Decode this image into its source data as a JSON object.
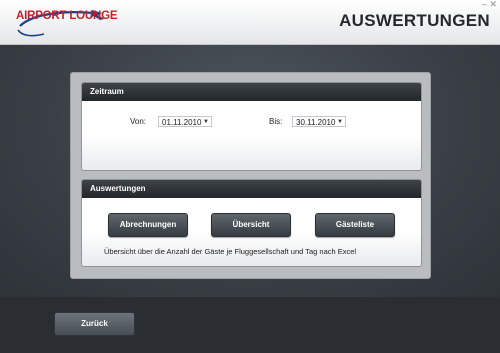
{
  "header": {
    "logo_text": "AIRPORT LOUNGE",
    "title": "AUSWERTUNGEN",
    "min_glyph": "–",
    "close_glyph": "✕",
    "logo_icon": "airplane-swoosh-icon"
  },
  "zeitraum": {
    "heading": "Zeitraum",
    "from_label": "Von:",
    "from_value": "01.11.2010",
    "to_label": "Bis:",
    "to_value": "30.11.2010"
  },
  "auswertungen": {
    "heading": "Auswertungen",
    "buttons": [
      "Abrechnungen",
      "Übersicht",
      "Gästeliste"
    ],
    "description": "Übersicht über die Anzahl der Gäste je Fluggesellschaft und Tag nach Excel"
  },
  "footer": {
    "back_label": "Zurück"
  },
  "colors": {
    "brand_red": "#c8202a",
    "panel_header": "#2b3035",
    "button_dark": "#3f464b"
  }
}
